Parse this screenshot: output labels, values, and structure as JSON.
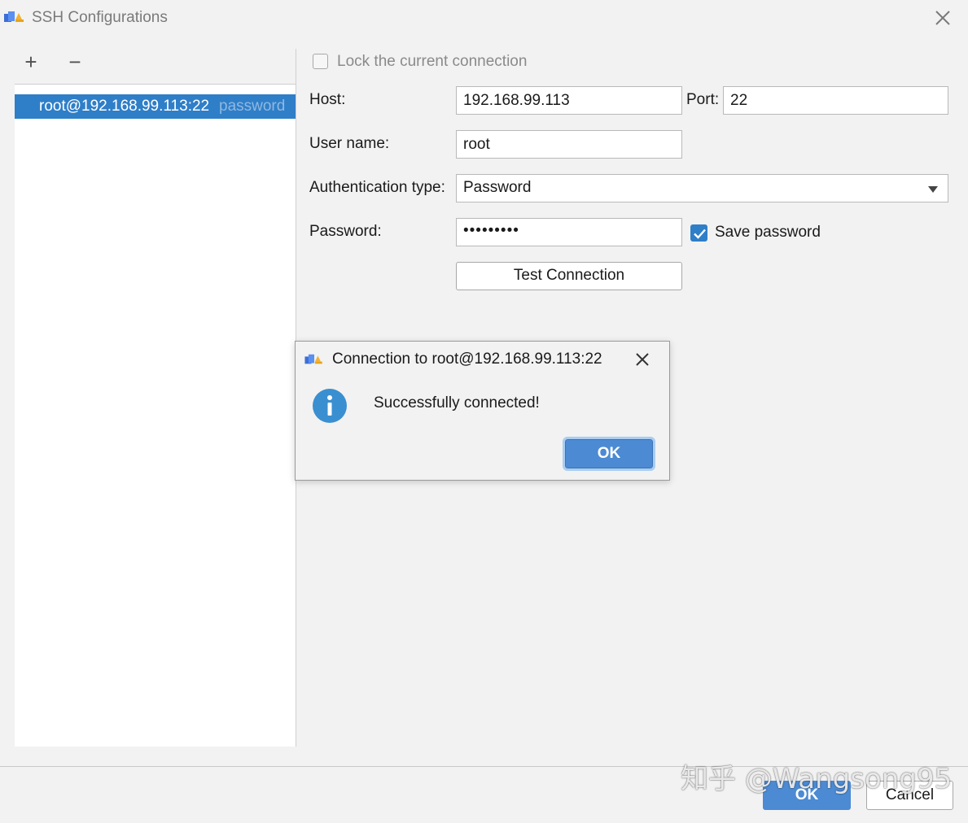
{
  "window": {
    "title": "SSH Configurations",
    "close_icon": "close-icon"
  },
  "toolbar": {
    "add_label": "+",
    "remove_label": "−"
  },
  "config_list": {
    "items": [
      {
        "label": "root@192.168.99.113:22",
        "sub": "password",
        "selected": true
      }
    ]
  },
  "form": {
    "lock_label": "Lock the current connection",
    "lock_checked": false,
    "host_label": "Host:",
    "host_value": "192.168.99.113",
    "port_label": "Port:",
    "port_value": "22",
    "username_label": "User name:",
    "username_value": "root",
    "auth_label": "Authentication type:",
    "auth_value": "Password",
    "password_label": "Password:",
    "password_value": "•••••••••",
    "save_password_label": "Save password",
    "save_password_checked": true,
    "test_button": "Test Connection"
  },
  "dialog": {
    "title": "Connection to root@192.168.99.113:22",
    "message": "Successfully connected!",
    "ok_label": "OK",
    "icon": "info-icon"
  },
  "footer": {
    "ok_label": "OK",
    "cancel_label": "Cancel"
  },
  "watermark": "知乎 @Wangsong95",
  "colors": {
    "accent": "#2f7ec8",
    "button_primary": "#4c8ad3",
    "background": "#f2f2f2"
  }
}
